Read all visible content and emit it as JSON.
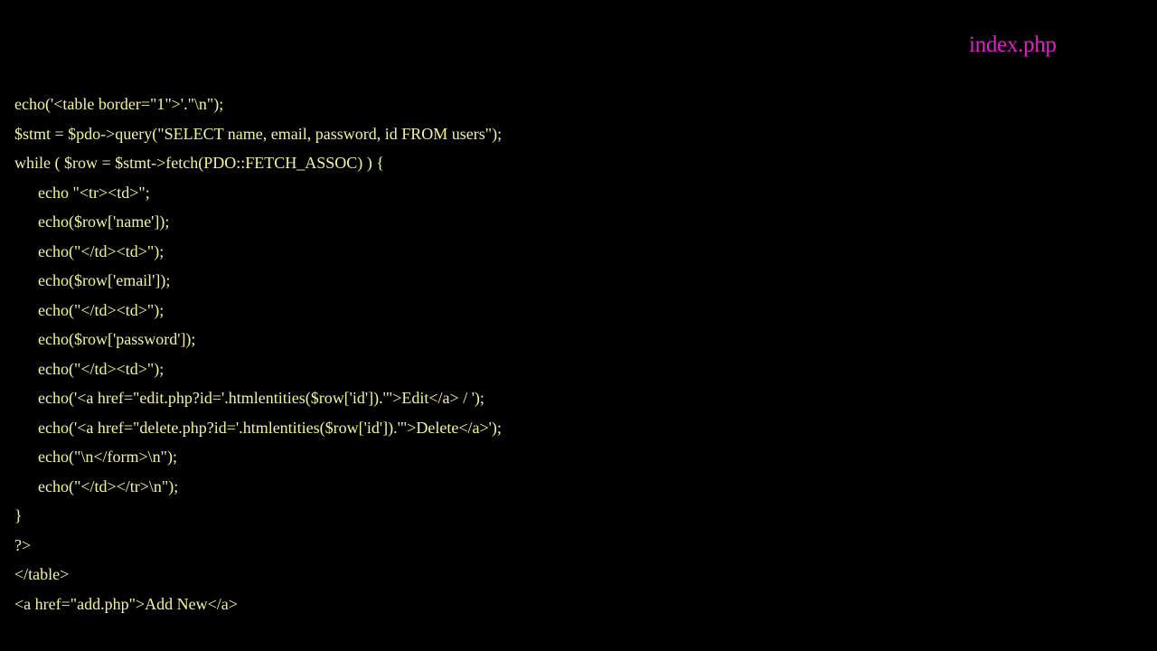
{
  "slide": {
    "title": "index.php",
    "colors": {
      "background": "#000000",
      "title": "#e020c8",
      "code": "#f4f49a"
    },
    "code_lines": [
      {
        "text": "echo('<table border=\"1\">'.\"\\n\");",
        "indent": false
      },
      {
        "text": "$stmt = $pdo->query(\"SELECT name, email, password, id FROM users\");",
        "indent": false
      },
      {
        "text": "while ( $row = $stmt->fetch(PDO::FETCH_ASSOC) ) {",
        "indent": false
      },
      {
        "text": "echo \"<tr><td>\";",
        "indent": true
      },
      {
        "text": "echo($row['name']);",
        "indent": true
      },
      {
        "text": "echo(\"</td><td>\");",
        "indent": true
      },
      {
        "text": "echo($row['email']);",
        "indent": true
      },
      {
        "text": "echo(\"</td><td>\");",
        "indent": true
      },
      {
        "text": "echo($row['password']);",
        "indent": true
      },
      {
        "text": "echo(\"</td><td>\");",
        "indent": true
      },
      {
        "text": "echo('<a href=\"edit.php?id='.htmlentities($row['id']).'\">Edit</a> / ');",
        "indent": true
      },
      {
        "text": "echo('<a href=\"delete.php?id='.htmlentities($row['id']).'\">Delete</a>');",
        "indent": true
      },
      {
        "text": "echo(\"\\n</form>\\n\");",
        "indent": true
      },
      {
        "text": "echo(\"</td></tr>\\n\");",
        "indent": true
      },
      {
        "text": "}",
        "indent": false
      },
      {
        "text": "?>",
        "indent": false
      },
      {
        "text": "</table>",
        "indent": false
      },
      {
        "text": "<a href=\"add.php\">Add New</a>",
        "indent": false
      }
    ]
  }
}
